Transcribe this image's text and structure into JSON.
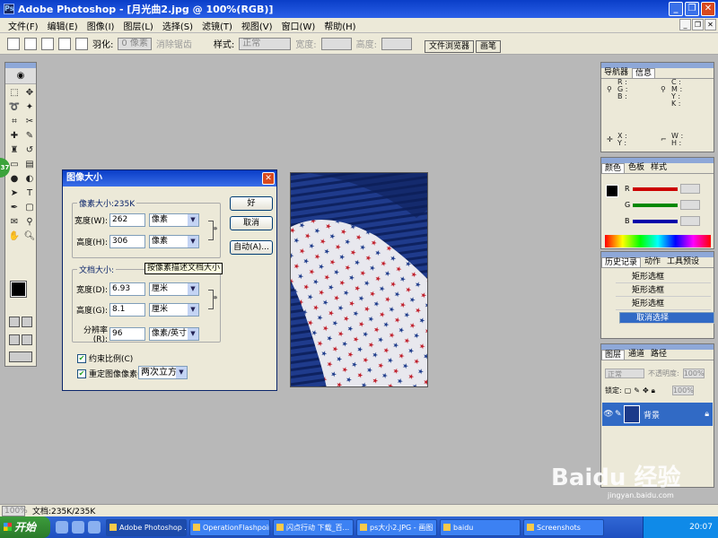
{
  "window": {
    "title": "Adobe Photoshop - [月光曲2.jpg @ 100%(RGB)]"
  },
  "menu": [
    "文件(F)",
    "编辑(E)",
    "图像(I)",
    "图层(L)",
    "选择(S)",
    "滤镜(T)",
    "视图(V)",
    "窗口(W)",
    "帮助(H)"
  ],
  "options": {
    "feather_label": "羽化:",
    "feather_value": "0 像素",
    "antialias": "消除锯齿",
    "style_label": "样式:",
    "style_value": "正常",
    "width_label": "宽度:",
    "height_label": "高度:",
    "tab_file_browser": "文件浏览器",
    "tab_brushes": "画笔"
  },
  "dialog": {
    "title": "图像大小",
    "pixel_group": "像素大小:235K",
    "width_label": "宽度(W):",
    "width_value": "262",
    "width_unit": "像素",
    "height_label": "高度(H):",
    "height_value": "306",
    "height_unit": "像素",
    "doc_group": "文档大小:",
    "doc_width_label": "宽度(D):",
    "doc_width_value": "6.93",
    "doc_width_unit": "厘米",
    "doc_height_label": "高度(G):",
    "doc_height_value": "8.1",
    "doc_height_unit": "厘米",
    "res_label": "分辨率(R):",
    "res_value": "96",
    "res_unit": "像素/英寸",
    "constrain": "约束比例(C)",
    "resample": "重定图像像素(I):",
    "resample_method": "两次立方",
    "ok": "好",
    "cancel": "取消",
    "auto": "自动(A)...",
    "tooltip": "按像素描述文档大小"
  },
  "navigator": {
    "tabs": [
      "导航器",
      "信息"
    ],
    "rgb": "R :\nG :\nB :",
    "cmyk": "C :\nM :\nY :\nK :",
    "xy": "X :\nY :",
    "wh": "W :\nH :"
  },
  "color": {
    "tabs": [
      "颜色",
      "色板",
      "样式"
    ],
    "channels": [
      "R",
      "G",
      "B"
    ]
  },
  "history": {
    "tabs": [
      "历史记录",
      "动作",
      "工具预设"
    ],
    "items": [
      "矩形选框",
      "矩形选框",
      "矩形选框",
      "取消选择"
    ]
  },
  "layers": {
    "tabs": [
      "图层",
      "通道",
      "路径"
    ],
    "blend_mode": "正常",
    "opacity_label": "不透明度:",
    "opacity_value": "100%",
    "lock_label": "锁定:",
    "fill_value": "100%",
    "layer_name": "背景"
  },
  "status": {
    "zoom": "100%",
    "doc": "文档:235K/235K"
  },
  "taskbar": {
    "start": "开始",
    "tasks": [
      "Adobe Photoshop ...",
      "OperationFlashpoint",
      "闪点行动 下载_百...",
      "ps大小2.JPG - 画图",
      "baidu",
      "Screenshots"
    ],
    "clock": "20:07"
  },
  "watermark": {
    "brand": "Baidu 经验",
    "url": "jingyan.baidu.com"
  },
  "icons": {
    "tools": [
      "marquee-icon",
      "move-icon",
      "lasso-icon",
      "magic-wand-icon",
      "crop-icon",
      "slice-icon",
      "heal-icon",
      "brush-icon",
      "stamp-icon",
      "history-brush-icon",
      "eraser-icon",
      "gradient-icon",
      "blur-icon",
      "dodge-icon",
      "path-select-icon",
      "type-icon",
      "pen-icon",
      "shape-icon",
      "notes-icon",
      "eyedropper-icon",
      "hand-icon",
      "zoom-icon"
    ]
  },
  "colors": {
    "accent": "#316ac5",
    "titlebar": "#0a3ec8",
    "photo_blue": "#1c3a8a",
    "star_red": "#c01c28",
    "star_blue": "#1c3a8a"
  }
}
